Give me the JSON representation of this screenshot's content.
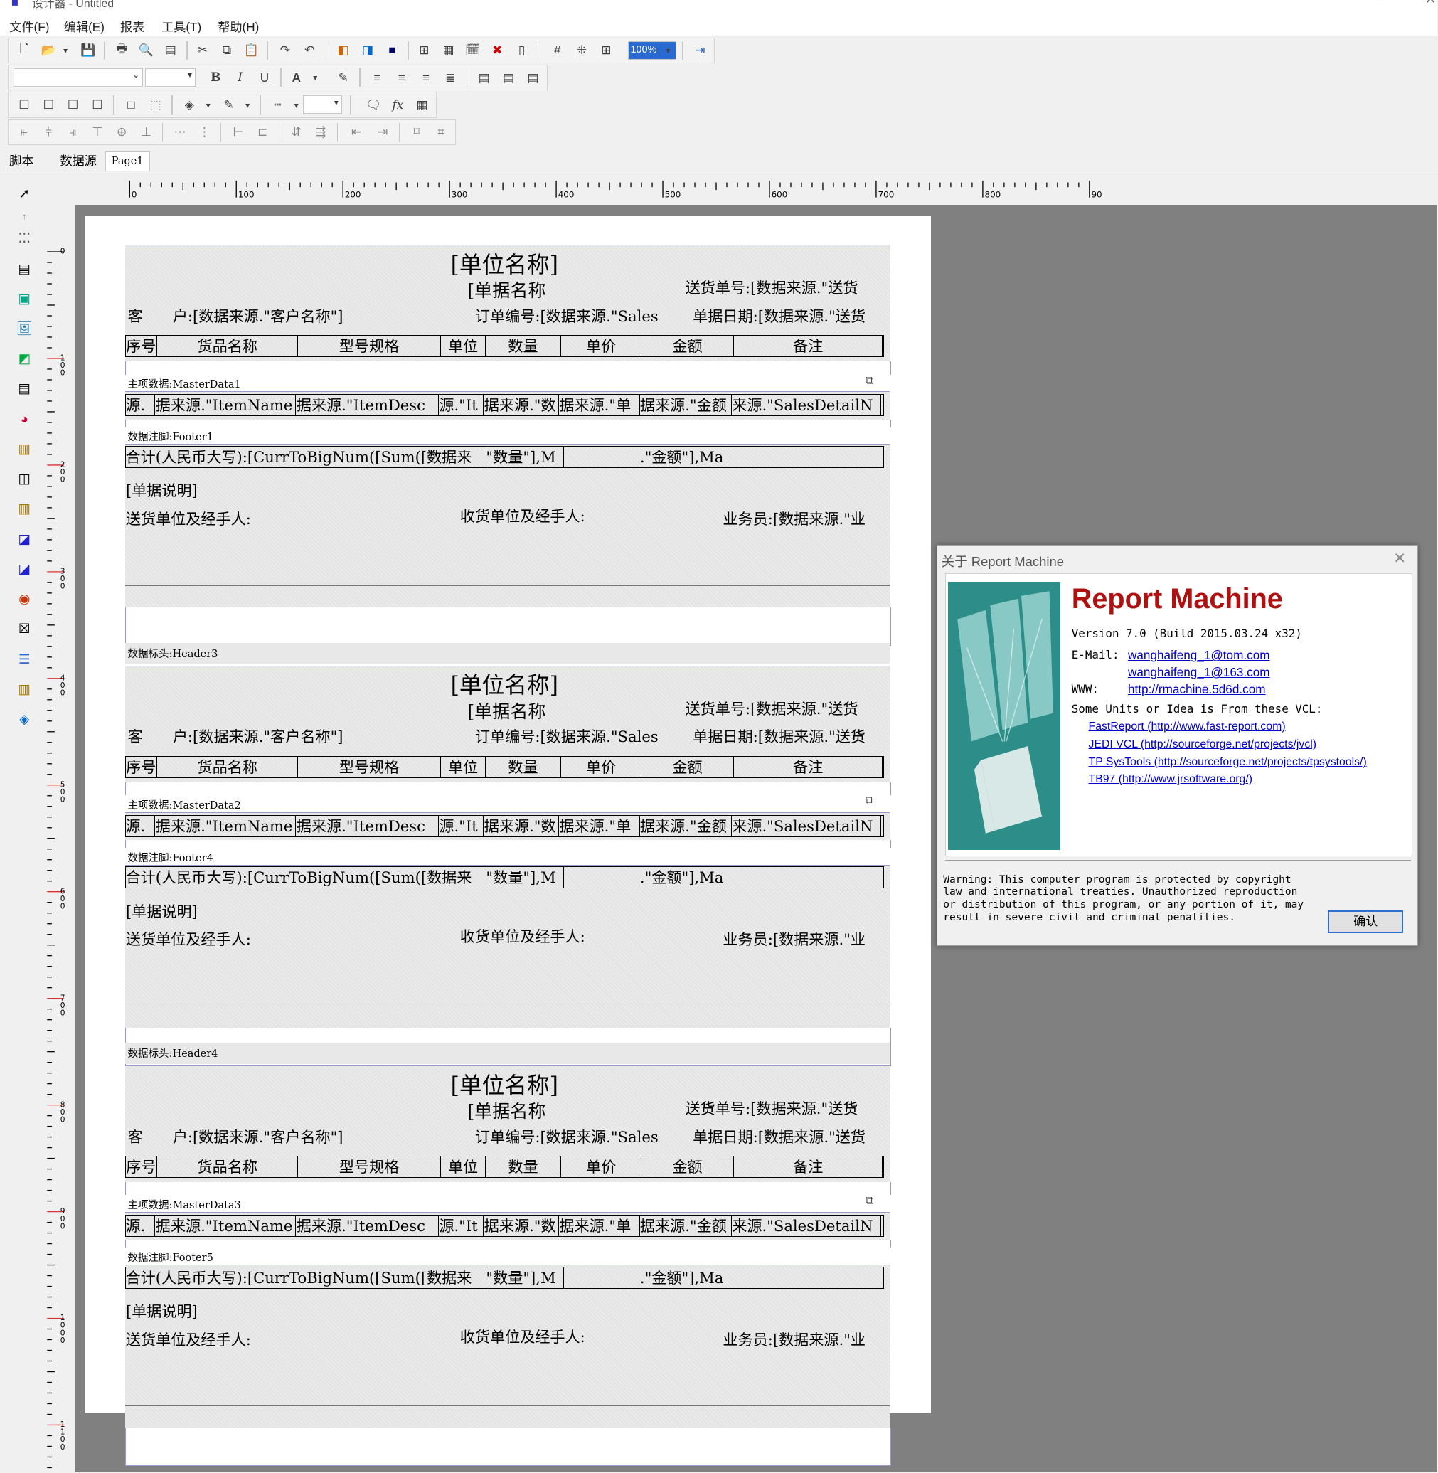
{
  "window": {
    "title": "设计器 - Untitled"
  },
  "menu": [
    "文件(F)",
    "编辑(E)",
    "报表",
    "工具(T)",
    "帮助(H)"
  ],
  "toolbar": {
    "zoom": "100%"
  },
  "tabs": [
    "脚本",
    "数据源",
    "Page1"
  ],
  "ruler": {
    "h_labels": [
      "0",
      "100",
      "200",
      "300",
      "400",
      "500",
      "600",
      "700",
      "800",
      "90"
    ],
    "v_labels": [
      "0",
      "100",
      "200",
      "300",
      "400",
      "500",
      "600",
      "700",
      "800",
      "900",
      "1000",
      "1100"
    ]
  },
  "report": {
    "unit_name": "[单位名称]",
    "doc_name": "[单据名称",
    "delivery_no": "送货单号:[数据来源.\"送货",
    "customer": "客　　户:[数据来源.\"客户名称\"]",
    "order_no": "订单编号:[数据来源.\"Sales",
    "doc_date": "单据日期:[数据来源.\"送货",
    "headers": [
      "序号",
      "货品名称",
      "型号规格",
      "单位",
      "数量",
      "单价",
      "金额",
      "备注"
    ],
    "master_cells": [
      "源.",
      "据来源.\"ItemName",
      "据来源.\"ItemDesc",
      "源.\"It",
      "据来源.\"数",
      "据来源.\"单",
      "据来源.\"金额",
      "来源.\"SalesDetailN"
    ],
    "footer_total": "合计(人民币大写):[CurrToBigNum([Sum([数据来",
    "footer_qty": "\"数量\"],M",
    "footer_amt": ".\"金额\"],Ma",
    "doc_note": "[单据说明]",
    "sender": "送货单位及经手人:",
    "receiver": "收货单位及经手人:",
    "salesman": "业务员:[数据来源.\"业",
    "bands": {
      "master1": "主项数据:MasterData1",
      "footer1": "数据注脚:Footer1",
      "header3": "数据标头:Header3",
      "master2": "主项数据:MasterData2",
      "footer4": "数据注脚:Footer4",
      "header4": "数据标头:Header4",
      "master3": "主项数据:MasterData3",
      "footer5": "数据注脚:Footer5"
    }
  },
  "about": {
    "title": "关于 Report Machine",
    "product": "Report Machine",
    "version": "Version 7.0 (Build 2015.03.24 x32)",
    "email_label": "E-Mail:",
    "email1": "wanghaifeng_1@tom.com",
    "email2": "wanghaifeng_1@163.com",
    "www_label": "WWW:",
    "www": "http://rmachine.5d6d.com",
    "units_intro": "Some Units or Idea is From these VCL:",
    "vcl": [
      "FastReport (http://www.fast-report.com)",
      "JEDI VCL (http://sourceforge.net/projects/jvcl)",
      "TP SysTools (http://sourceforge.net/projects/tpsystools/)",
      "TB97 (http://www.jrsoftware.org/)"
    ],
    "warning": "Warning: This computer program is protected by copyright law and international treaties. Unauthorized reproduction or distribution of this program, or any portion of it, may result in severe civil and criminal penalities.",
    "ok": "确认"
  }
}
